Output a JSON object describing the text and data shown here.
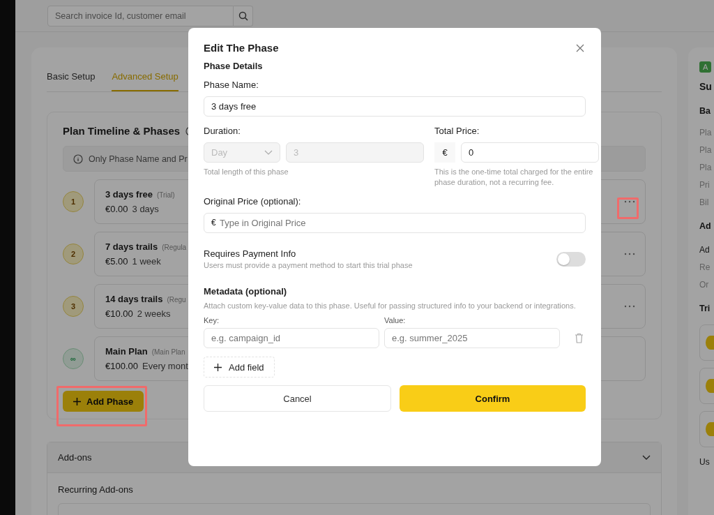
{
  "search": {
    "placeholder": "Search invoice Id, customer email"
  },
  "tabs": [
    {
      "label": "Basic Setup",
      "selected": false
    },
    {
      "label": "Advanced Setup",
      "selected": true
    }
  ],
  "timeline": {
    "title": "Plan Timeline & Phases",
    "notice": "Only Phase Name and Pr",
    "phases": [
      {
        "kind": "numbered",
        "marker": "1",
        "name": "3 days free",
        "type": "(Trial)",
        "price": "€0.00",
        "duration": "3 days",
        "has_menu": true,
        "menu_highlighted": true
      },
      {
        "kind": "numbered",
        "marker": "2",
        "name": "7 days trails",
        "type": "(Regula",
        "price": "€5.00",
        "duration": "1 week",
        "has_menu": true,
        "menu_highlighted": false
      },
      {
        "kind": "numbered",
        "marker": "3",
        "name": "14 days trails",
        "type": "(Regu",
        "price": "€10.00",
        "duration": "2 weeks",
        "has_menu": true,
        "menu_highlighted": false
      },
      {
        "kind": "main",
        "marker": "∞",
        "name": "Main Plan",
        "type": "(Main Plan",
        "price": "€100.00",
        "duration": "Every mont",
        "has_menu": false
      }
    ],
    "add_phase": {
      "label": "Add Phase",
      "highlighted": true
    }
  },
  "addons": {
    "title": "Add-ons",
    "expanded": true,
    "section": "Recurring Add-ons"
  },
  "side": {
    "badge": "A",
    "title": "Su",
    "items": [
      {
        "kind": "heading",
        "text": "Ba"
      },
      {
        "kind": "row",
        "text": "Pla"
      },
      {
        "kind": "row",
        "text": "Pla"
      },
      {
        "kind": "row",
        "text": "Pla"
      },
      {
        "kind": "row",
        "text": "Pri"
      },
      {
        "kind": "row",
        "text": "Bil"
      },
      {
        "kind": "heading",
        "text": "Ad"
      },
      {
        "kind": "label",
        "text": "Ad"
      },
      {
        "kind": "row",
        "text": "Re"
      },
      {
        "kind": "row",
        "text": "Or"
      },
      {
        "kind": "heading",
        "text": "Tri"
      },
      {
        "kind": "card"
      },
      {
        "kind": "card"
      },
      {
        "kind": "card"
      },
      {
        "kind": "label",
        "text": "Us"
      }
    ]
  },
  "modal": {
    "title": "Edit The Phase",
    "section": "Phase Details",
    "name_label": "Phase Name:",
    "name_value": "3 days free",
    "duration_label": "Duration:",
    "duration_unit": "Day",
    "duration_value": "3",
    "duration_disabled": true,
    "duration_hint": "Total length of this phase",
    "price_label": "Total Price:",
    "currency": "€",
    "price_value": "0",
    "price_hint": "This is the one-time total charged for the entire phase duration, not a recurring fee.",
    "original_label": "Original Price (optional):",
    "original_currency": "€",
    "original_placeholder": "Type in Original Price",
    "payment_title": "Requires Payment Info",
    "payment_hint": "Users must provide a payment method to start this trial phase",
    "payment_on": false,
    "meta_title": "Metadata (optional)",
    "meta_hint": "Attach custom key-value data to this phase. Useful for passing structured info to your backend or integrations.",
    "key_label": "Key:",
    "key_placeholder": "e.g. campaign_id",
    "value_label": "Value:",
    "value_placeholder": "e.g. summer_2025",
    "add_field": "Add field",
    "cancel": "Cancel",
    "confirm": "Confirm"
  }
}
